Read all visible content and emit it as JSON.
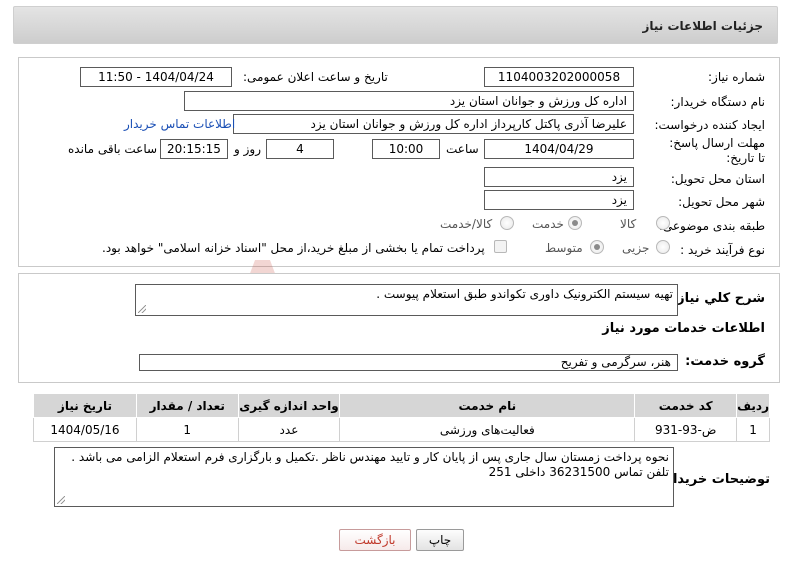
{
  "header": {
    "title": "جزئیات اطلاعات نیاز"
  },
  "fields": {
    "need_number_label": "شماره نیاز:",
    "need_number": "1104003202000058",
    "announce_label": "تاریخ و ساعت اعلان عمومی:",
    "announce_value": "1404/04/24 - 11:50",
    "buyer_org_label": "نام دستگاه خریدار:",
    "buyer_org": "اداره کل ورزش و جوانان استان یزد",
    "creator_label": "ایجاد کننده درخواست:",
    "creator": "علیرضا آذری پاکتل کارپرداز اداره کل ورزش و جوانان استان یزد",
    "contact_link": "اطلاعات تماس خریدار",
    "deadline_label": "مهلت ارسال پاسخ: تا تاریخ:",
    "deadline_date": "1404/04/29",
    "time_label": "ساعت",
    "deadline_time": "10:00",
    "days_value": "4",
    "days_label": "روز و",
    "remaining_time": "20:15:15",
    "remaining_label": "ساعت باقی مانده",
    "province_label": "استان محل تحویل:",
    "province": "یزد",
    "city_label": "شهر محل تحویل:",
    "city": "یزد",
    "category_label": "طبقه بندی موضوعی:",
    "category_options": [
      "کالا",
      "خدمت",
      "کالا/خدمت"
    ],
    "process_label": "نوع فرآیند خرید :",
    "process_options": [
      "جزیی",
      "متوسط"
    ],
    "payment_note": "پرداخت تمام یا بخشی از مبلغ خرید،از محل \"اسناد خزانه اسلامی\" خواهد بود."
  },
  "summary": {
    "label": "شرح کلي نياز:",
    "text": "تهیه سیستم الکترونیک داوری تکواندو طبق استعلام پیوست ."
  },
  "services": {
    "section_title": "اطلاعات خدمات مورد نياز",
    "group_label": "گروه خدمت:",
    "group_value": "هنر، سرگرمی و تفریح",
    "columns": [
      "ردیف",
      "کد خدمت",
      "نام خدمت",
      "واحد اندازه گیری",
      "تعداد / مقدار",
      "تاریخ نیاز"
    ],
    "rows": [
      [
        "1",
        "ض-93-931",
        "فعالیت‌های ورزشی",
        "عدد",
        "1",
        "1404/05/16"
      ]
    ]
  },
  "buyer_notes": {
    "label": "توضیحات خریدار:",
    "line1": "نحوه پرداخت زمستان سال جاری پس از پایان کار و تایید مهندس ناظر .تکمیل و بارگزاری فرم استعلام  الزامی می باشد .",
    "line2": "تلفن تماس 36231500 داخلی 251"
  },
  "buttons": {
    "print": "چاپ",
    "back": "بازگشت"
  },
  "watermark": {
    "text": "AriaTender.neT"
  }
}
